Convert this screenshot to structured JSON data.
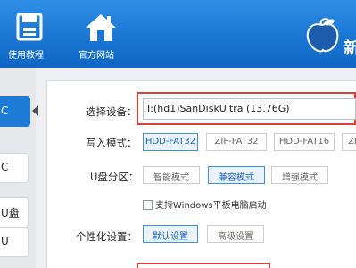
{
  "topbar": {
    "nav": [
      {
        "label": "使用教程",
        "icon": "floppy-disk-icon"
      },
      {
        "label": "官方网站",
        "icon": "home-icon"
      }
    ],
    "brand_char": "新",
    "brand_icon": "peach-logo-icon"
  },
  "sidebar": {
    "items": [
      "C",
      "C",
      "U盘",
      "U"
    ]
  },
  "form": {
    "device_label": "选择设备：",
    "device_value": "I:(hd1)SanDiskUltra (13.76G)",
    "write_mode_label": "写入模式：",
    "write_modes": [
      "HDD-FAT32",
      "ZIP-FAT32",
      "HDD-FAT16",
      "ZIP"
    ],
    "write_mode_selected": "HDD-FAT32",
    "partition_label": "U盘分区：",
    "partitions": [
      "智能模式",
      "兼容模式",
      "增强模式"
    ],
    "partition_selected": "兼容模式",
    "tablet_checkbox_label": "支持Windows平板电脑启动",
    "custom_label": "个性化设置：",
    "custom_options": [
      "默认设置",
      "高级设置"
    ],
    "custom_selected": "默认设置"
  },
  "colors": {
    "topbar": "#1a76d4",
    "highlight_red": "#d9413b",
    "selected_blue": "#3d8fe0"
  }
}
